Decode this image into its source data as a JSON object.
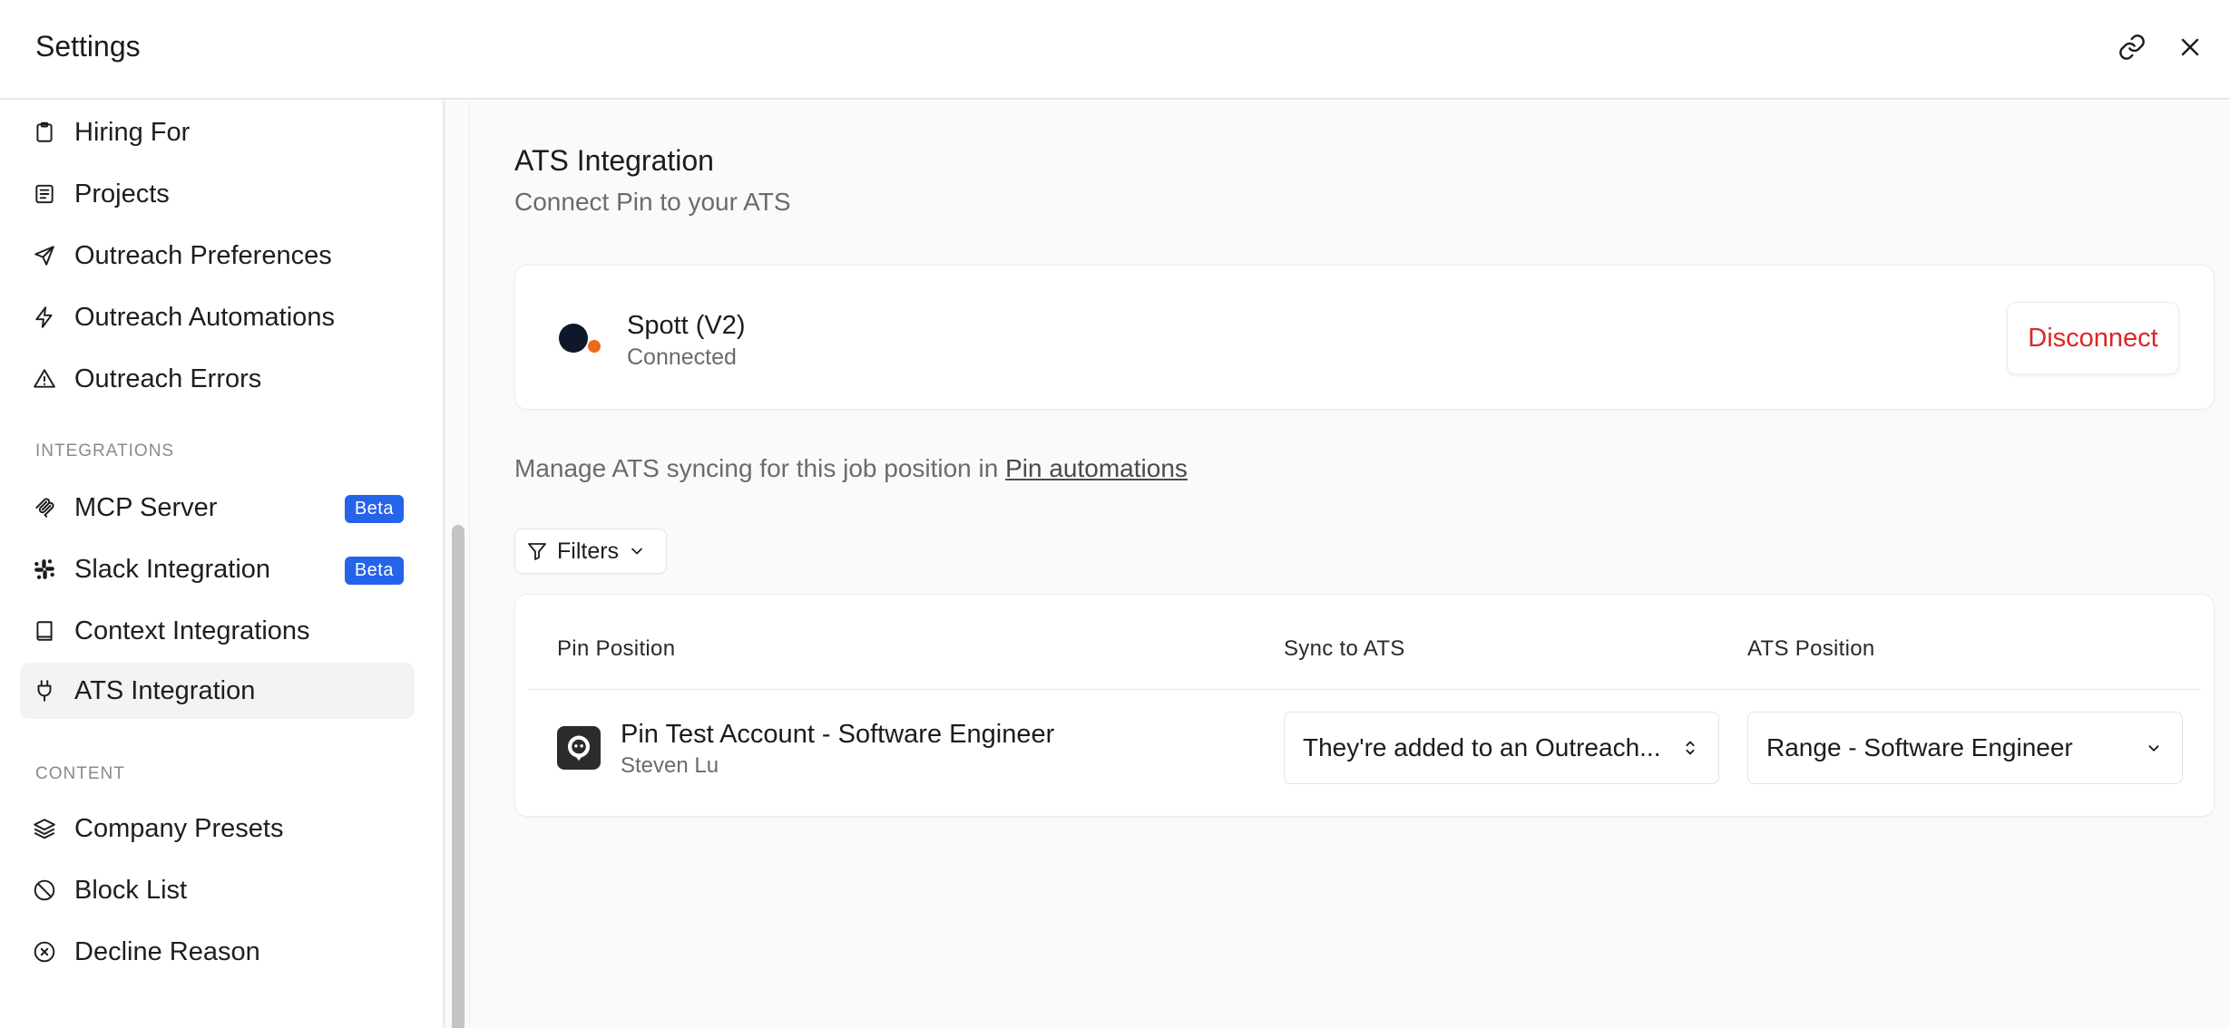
{
  "header": {
    "title": "Settings"
  },
  "sidebar": {
    "items_top": [
      {
        "label": "Hiring For",
        "icon": "clipboard-icon"
      },
      {
        "label": "Projects",
        "icon": "document-list-icon"
      },
      {
        "label": "Outreach Preferences",
        "icon": "send-icon"
      },
      {
        "label": "Outreach Automations",
        "icon": "lightning-icon"
      },
      {
        "label": "Outreach Errors",
        "icon": "warning-icon"
      }
    ],
    "integrations_label": "INTEGRATIONS",
    "integrations": [
      {
        "label": "MCP Server",
        "icon": "mcp-icon",
        "badge": "Beta"
      },
      {
        "label": "Slack Integration",
        "icon": "slack-icon",
        "badge": "Beta"
      },
      {
        "label": "Context Integrations",
        "icon": "book-icon"
      },
      {
        "label": "ATS Integration",
        "icon": "plug-icon",
        "active": true
      }
    ],
    "content_label": "CONTENT",
    "content": [
      {
        "label": "Company Presets",
        "icon": "layers-icon"
      },
      {
        "label": "Block List",
        "icon": "ban-icon"
      },
      {
        "label": "Decline Reason",
        "icon": "x-circle-icon"
      }
    ]
  },
  "main": {
    "title": "ATS Integration",
    "subtitle": "Connect Pin to your ATS",
    "connection": {
      "name": "Spott (V2)",
      "status": "Connected",
      "disconnect_label": "Disconnect"
    },
    "manage_text": "Manage ATS syncing for this job position in ",
    "manage_link": "Pin automations",
    "filters_label": "Filters",
    "table": {
      "headers": [
        "Pin Position",
        "Sync to ATS",
        "ATS Position"
      ],
      "rows": [
        {
          "title": "Pin Test Account - Software Engineer",
          "owner": "Steven Lu",
          "sync": "They're added to an Outreach...",
          "ats_position": "Range - Software Engineer"
        }
      ]
    }
  },
  "colors": {
    "accent_blue": "#2563eb",
    "danger": "#dc2626",
    "logo_dark": "#0f172a",
    "logo_orange": "#ea6a1f"
  }
}
